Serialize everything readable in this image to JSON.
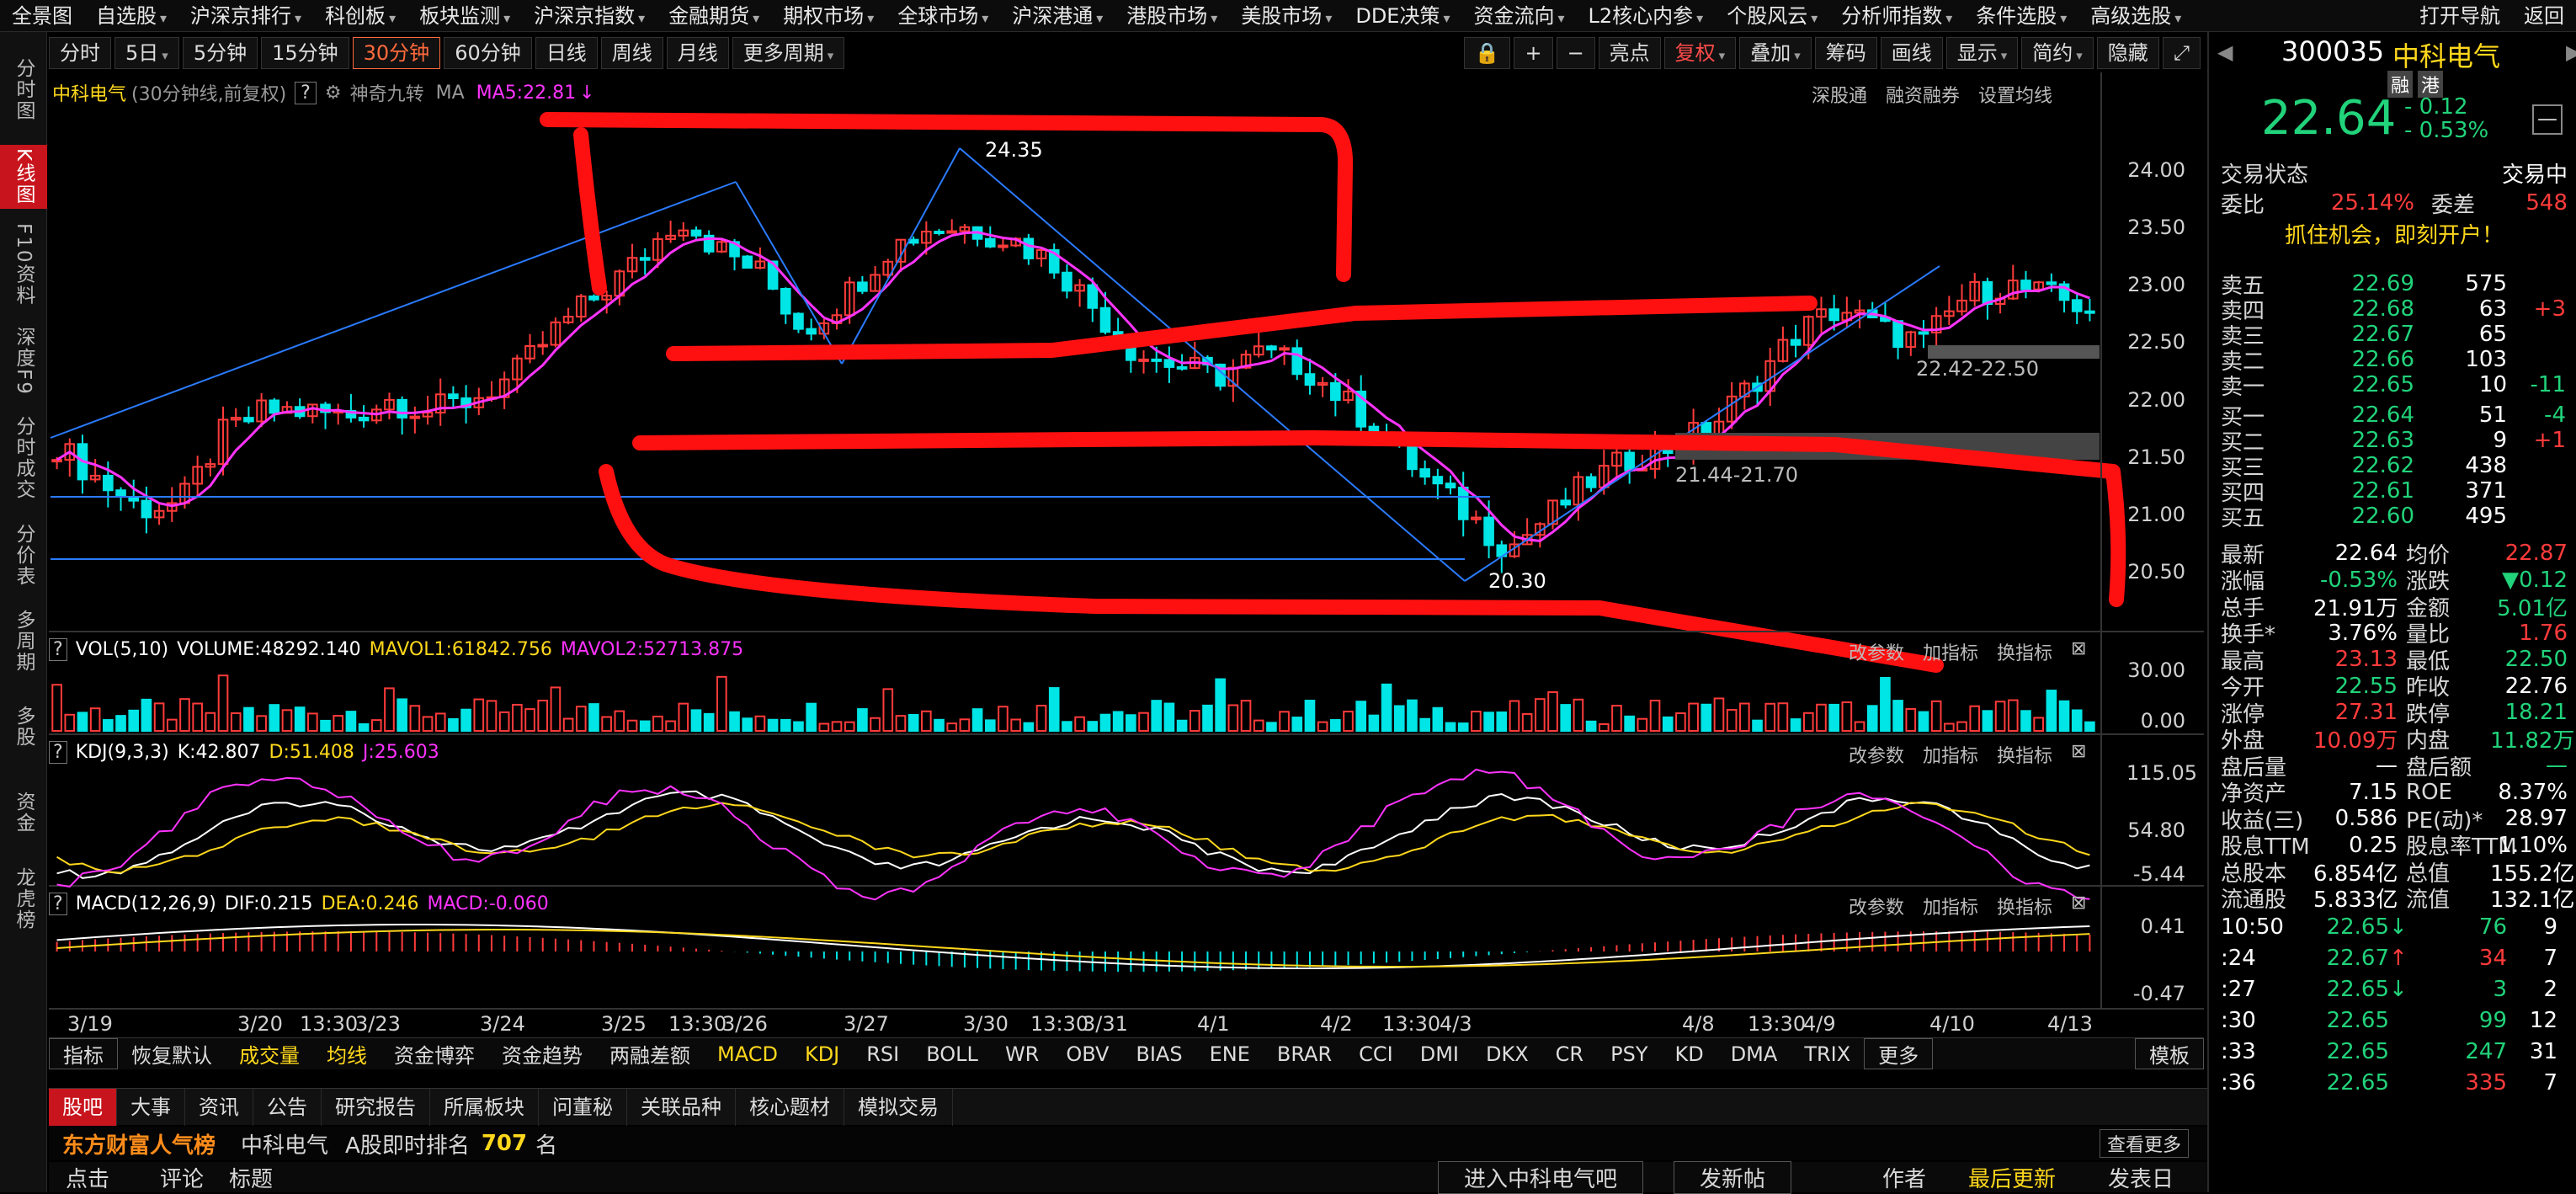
{
  "topnav": [
    "全景图",
    "自选股",
    "沪深京排行",
    "科创板",
    "板块监测",
    "沪深京指数",
    "金融期货",
    "期权市场",
    "全球市场",
    "沪深港通",
    "港股市场",
    "美股市场",
    "DDE决策",
    "资金流向",
    "L2核心内参",
    "个股风云",
    "分析师指数",
    "条件选股",
    "高级选股",
    "打开导航",
    "返回"
  ],
  "leftnav": [
    "分时图",
    "K线图",
    "F10资料",
    "深度F9",
    "分时成交",
    "分价表",
    "多周期",
    "多股",
    "资金",
    "龙虎榜"
  ],
  "toolbar": {
    "periods": [
      "分时",
      "5日",
      "5分钟",
      "15分钟",
      "30分钟",
      "60分钟",
      "日线",
      "周线",
      "月线",
      "更多周期"
    ],
    "active": "30分钟",
    "tools": [
      "亮点",
      "复权",
      "叠加",
      "筹码",
      "画线",
      "显示",
      "简约",
      "隐藏"
    ]
  },
  "header": {
    "name": "中科电气",
    "subtitle": "(30分钟线,前复权)",
    "help": "?",
    "nine": "神奇九转",
    "ma": "MA",
    "ma5": "MA5:22.81",
    "right": [
      "深股通",
      "融资融券",
      "设置均线"
    ]
  },
  "kline": {
    "annotations": {
      "high": "24.35",
      "low": "20.30",
      "zone1": "22.42-22.50",
      "zone2": "21.44-21.70"
    },
    "y_ticks": [
      "24.00",
      "23.50",
      "23.00",
      "22.50",
      "22.00",
      "21.50",
      "21.00",
      "20.50"
    ],
    "x_labels": [
      "3/19",
      "3/20",
      "13:30",
      "3/23",
      "3/24",
      "3/25",
      "13:30",
      "3/26",
      "3/27",
      "3/30",
      "13:30",
      "3/31",
      "4/1",
      "4/2",
      "13:30",
      "4/3",
      "4/8",
      "13:30",
      "4/9",
      "4/10",
      "4/13"
    ],
    "ymin": 20.2,
    "ymax": 24.6
  },
  "vol": {
    "label": "VOL(5,10)",
    "volume": "VOLUME:48292.140",
    "mavol1": "MAVOL1:61842.756",
    "mavol2": "MAVOL2:52713.875",
    "y_ticks": [
      "30.00",
      "0.00"
    ]
  },
  "kdj": {
    "label": "KDJ(9,3,3)",
    "k": "K:42.807",
    "d": "D:51.408",
    "j": "J:25.603",
    "y_ticks": [
      "115.05",
      "54.80",
      "-5.44"
    ]
  },
  "macd": {
    "label": "MACD(12,26,9)",
    "dif": "DIF:0.215",
    "dea": "DEA:0.246",
    "macd": "MACD:-0.060",
    "y_ticks": [
      "0.41",
      "-0.47"
    ]
  },
  "panel_buttons": [
    "改参数",
    "加指标",
    "换指标"
  ],
  "indicator_tabs": [
    "指标",
    "恢复默认",
    "成交量",
    "均线",
    "资金博弈",
    "资金趋势",
    "两融差额",
    "MACD",
    "KDJ",
    "RSI",
    "BOLL",
    "WR",
    "OBV",
    "BIAS",
    "ENE",
    "BRAR",
    "CCI",
    "DMI",
    "DKX",
    "CR",
    "PSY",
    "KD",
    "DMA",
    "TRIX",
    "更多",
    "模板"
  ],
  "bottom_tabs": [
    "股吧",
    "大事",
    "资讯",
    "公告",
    "研究报告",
    "所属板块",
    "问董秘",
    "关联品种",
    "核心题材",
    "模拟交易"
  ],
  "popularity": {
    "brand": "东方财富人气榜",
    "stock": "中科电气",
    "rank_label": "A股即时排名",
    "rank": "707",
    "unit": "名",
    "more": "查看更多"
  },
  "comment_bar": {
    "cols": [
      "点击",
      "评论",
      "标题"
    ],
    "enter": "进入中科电气吧",
    "post": "发新帖",
    "author": "作者",
    "latest": "最后更新",
    "posttime": "发表日"
  },
  "quote": {
    "code": "300035",
    "name": "中科电气",
    "badges": [
      "融",
      "港"
    ],
    "price": "22.64",
    "change": "- 0.12",
    "pct": "- 0.53%",
    "status_label": "交易状态",
    "status": "交易中",
    "weibi_label": "委比",
    "weibi": "25.14%",
    "weicha_label": "委差",
    "weicha": "548",
    "promo": "抓住机会，即刻开户！"
  },
  "orderbook": {
    "sell": [
      {
        "l": "卖五",
        "p": "22.69",
        "v": "575",
        "c": ""
      },
      {
        "l": "卖四",
        "p": "22.68",
        "v": "63",
        "c": "+3"
      },
      {
        "l": "卖三",
        "p": "22.67",
        "v": "65",
        "c": ""
      },
      {
        "l": "卖二",
        "p": "22.66",
        "v": "103",
        "c": ""
      },
      {
        "l": "卖一",
        "p": "22.65",
        "v": "10",
        "c": "-11"
      }
    ],
    "buy": [
      {
        "l": "买一",
        "p": "22.64",
        "v": "51",
        "c": "-4"
      },
      {
        "l": "买二",
        "p": "22.63",
        "v": "9",
        "c": "+1"
      },
      {
        "l": "买三",
        "p": "22.62",
        "v": "438",
        "c": ""
      },
      {
        "l": "买四",
        "p": "22.61",
        "v": "371",
        "c": ""
      },
      {
        "l": "买五",
        "p": "22.60",
        "v": "495",
        "c": ""
      }
    ]
  },
  "stats": [
    [
      "最新",
      "22.64",
      "均价",
      "22.87"
    ],
    [
      "涨幅",
      "-0.53%",
      "涨跌",
      "▼0.12"
    ],
    [
      "总手",
      "21.91万",
      "金额",
      "5.01亿"
    ],
    [
      "换手*",
      "3.76%",
      "量比",
      "1.76"
    ],
    [
      "最高",
      "23.13",
      "最低",
      "22.50"
    ],
    [
      "今开",
      "22.55",
      "昨收",
      "22.76"
    ],
    [
      "涨停",
      "27.31",
      "跌停",
      "18.21"
    ],
    [
      "外盘",
      "10.09万",
      "内盘",
      "11.82万"
    ],
    [
      "盘后量",
      "—",
      "盘后额",
      "—"
    ],
    [
      "净资产",
      "7.15",
      "ROE",
      "8.37%"
    ],
    [
      "收益(三)",
      "0.586",
      "PE(动)*",
      "28.97"
    ],
    [
      "股息TTM",
      "0.25",
      "股息率TTM",
      "1.10%"
    ],
    [
      "总股本",
      "6.854亿",
      "总值",
      "155.2亿"
    ],
    [
      "流通股",
      "5.833亿",
      "流值",
      "132.1亿"
    ]
  ],
  "ticks": [
    [
      "10:50",
      "22.65",
      "↓",
      "76",
      "9"
    ],
    [
      ":24",
      "22.67",
      "↑",
      "34",
      "7"
    ],
    [
      ":27",
      "22.65",
      "↓",
      "3",
      "2"
    ],
    [
      ":30",
      "22.65",
      "",
      "99",
      "12"
    ],
    [
      ":33",
      "22.65",
      "",
      "247",
      "31"
    ],
    [
      ":36",
      "22.65",
      "",
      "335",
      "7"
    ]
  ],
  "colors": {
    "up": "#ff3b3b",
    "down": "#00e5e5",
    "ma": "#ff33ff",
    "accent": "#c8151d"
  }
}
